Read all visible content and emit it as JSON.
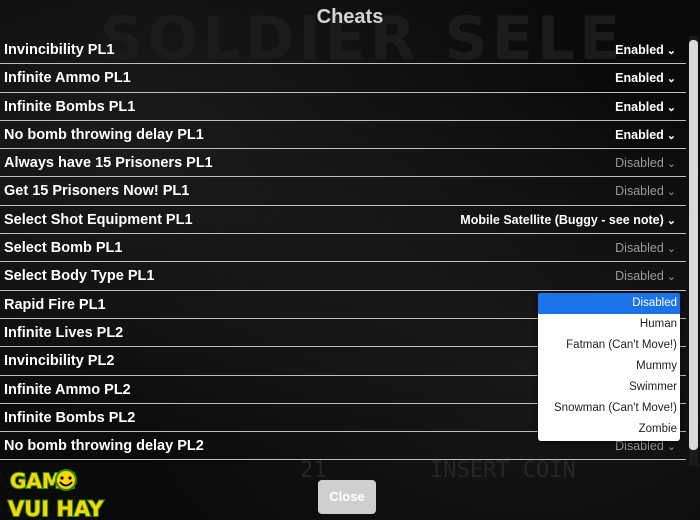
{
  "background": {
    "title": "SOLDIER SELECT",
    "hud_left": "21",
    "hud_right": "INSERT COIN"
  },
  "modal": {
    "title": "Cheats"
  },
  "cheats": [
    {
      "label": "Invincibility PL1",
      "value": "Enabled",
      "state": "enabled"
    },
    {
      "label": "Infinite Ammo PL1",
      "value": "Enabled",
      "state": "enabled"
    },
    {
      "label": "Infinite Bombs PL1",
      "value": "Enabled",
      "state": "enabled"
    },
    {
      "label": "No bomb throwing delay PL1",
      "value": "Enabled",
      "state": "enabled"
    },
    {
      "label": "Always have 15 Prisoners PL1",
      "value": "Disabled",
      "state": "disabled"
    },
    {
      "label": "Get 15 Prisoners Now! PL1",
      "value": "Disabled",
      "state": "disabled"
    },
    {
      "label": "Select Shot Equipment PL1",
      "value": "Mobile Satellite (Buggy - see note)",
      "state": "enabled"
    },
    {
      "label": "Select Bomb PL1",
      "value": "Disabled",
      "state": "disabled"
    },
    {
      "label": "Select Body Type PL1",
      "value": "Disabled",
      "state": "disabled"
    },
    {
      "label": "Rapid Fire PL1",
      "value": "",
      "state": "disabled"
    },
    {
      "label": "Infinite Lives PL2",
      "value": "",
      "state": "disabled"
    },
    {
      "label": "Invincibility PL2",
      "value": "",
      "state": "disabled"
    },
    {
      "label": "Infinite Ammo PL2",
      "value": "",
      "state": "disabled"
    },
    {
      "label": "Infinite Bombs PL2",
      "value": "",
      "state": "disabled"
    },
    {
      "label": "No bomb throwing delay PL2",
      "value": "Disabled",
      "state": "disabled"
    }
  ],
  "dropdown": {
    "options": [
      "Disabled",
      "Human",
      "Fatman (Can't Move!)",
      "Mummy",
      "Swimmer",
      "Snowman (Can't Move!)",
      "Zombie"
    ],
    "selected": "Disabled"
  },
  "close_button": {
    "label": "Close"
  },
  "logo": {
    "line1": "GAME",
    "line2": "VUI HAY"
  },
  "colors": {
    "accent": "#1a73e8",
    "logo_fill": "#ffd400",
    "logo_outline": "#1e8a1e"
  },
  "icons": {
    "select_arrow": "chevron-down-icon",
    "logo_face": "smiley-icon"
  }
}
